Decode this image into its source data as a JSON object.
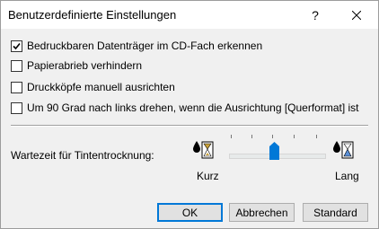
{
  "dialog": {
    "title": "Benutzerdefinierte Einstellungen",
    "help_glyph": "?",
    "close_icon": "close-icon"
  },
  "options": [
    {
      "label": "Bedruckbaren Datenträger im CD-Fach erkennen",
      "checked": true
    },
    {
      "label": "Papierabrieb verhindern",
      "checked": false
    },
    {
      "label": "Druckköpfe manuell ausrichten",
      "checked": false
    },
    {
      "label": "Um 90 Grad nach links drehen, wenn die Ausrichtung [Querformat] ist",
      "checked": false
    }
  ],
  "drying": {
    "label": "Wartezeit für Tintentrocknung:",
    "min_label": "Kurz",
    "max_label": "Lang",
    "icon_left": "ink-drying-short-icon",
    "icon_right": "ink-drying-long-icon",
    "position": 0.5
  },
  "buttons": {
    "ok": "OK",
    "cancel": "Abbrechen",
    "standard": "Standard"
  },
  "colors": {
    "accent": "#0078d7",
    "window_bg": "#f0f0f0",
    "titlebar_bg": "#ffffff"
  }
}
